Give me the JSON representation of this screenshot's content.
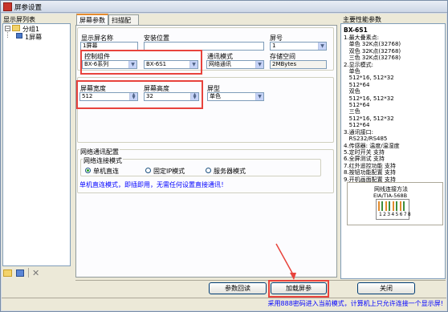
{
  "window": {
    "title": "屏参设置"
  },
  "left_panel": {
    "title": "显示屏列表",
    "tree": {
      "group": "分组1",
      "screen": "1屏幕"
    }
  },
  "tabs": [
    {
      "label": "屏幕参数"
    },
    {
      "label": "扫描配置"
    }
  ],
  "form": {
    "screen_name_label": "显示屏名称",
    "screen_name_value": "1屏幕",
    "install_location_label": "安装位置",
    "install_location_value": "",
    "screen_no_label": "屏号",
    "screen_no_value": "1",
    "controller_label": "控制组件",
    "controller_series": "BX-6系列",
    "controller_model": "BX-6S1",
    "comm_mode_label": "通讯模式",
    "comm_mode_value": "网络通讯",
    "storage_label": "存储空间",
    "storage_value": "2MBytes",
    "width_label": "屏幕宽度",
    "width_value": "512",
    "height_label": "屏幕高度",
    "height_value": "32",
    "type_label": "屏型",
    "type_value": "单色"
  },
  "network": {
    "title": "网络通讯配置",
    "mode_title": "网络连接模式",
    "options": [
      {
        "label": "单机直连",
        "selected": true
      },
      {
        "label": "固定IP模式",
        "selected": false
      },
      {
        "label": "服务器模式",
        "selected": false
      }
    ],
    "hint": "单机直连模式，即插即用，无需任何设置直接通讯！"
  },
  "right_panel": {
    "title": "主要性能参数",
    "model": "BX-6S1",
    "lines": [
      "1.最大叠素点:",
      "   单色 32K点(32768)",
      "   双色 32K点(32768)",
      "   三色 32K点(32768)",
      "2.显示模式:",
      "   单色",
      "   512*16, 512*32",
      "   512*64",
      "   双色",
      "   512*16, 512*32",
      "   512*64",
      "   三色",
      "   512*16, 512*32",
      "   512*64",
      "3.通讯接口:",
      "   RS232/RS485",
      "4.传感器: 温度/温湿度",
      "5.定时开关 支持",
      "6.全屏测试 支持",
      "7.红外遥控功能 支持",
      "8.按钮功能配置 支持",
      "9.开机画面配置 支持"
    ],
    "diagram_title": "网线连接方法",
    "diagram_subtitle": "EIA/TIA-568B",
    "diagram_pins": "12345678"
  },
  "buttons": {
    "readback": "参数回读",
    "load": "加载屏参",
    "close": "关闭"
  },
  "status": {
    "text": "采用888密码进入当前模式，计算机上只允许连接一个显示屏!"
  }
}
